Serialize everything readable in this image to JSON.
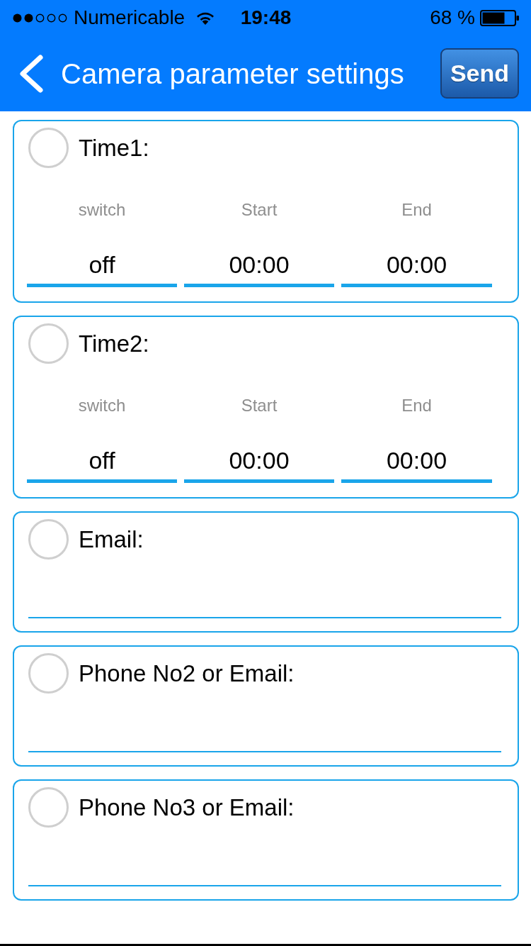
{
  "status_bar": {
    "carrier": "Numericable",
    "time": "19:48",
    "battery": "68 %"
  },
  "nav_bar": {
    "title": "Camera parameter settings",
    "send_button": "Send"
  },
  "sections": [
    {
      "kind": "schedule",
      "label": "Time1:",
      "selected": false,
      "columns": [
        {
          "header": "switch",
          "value": "off"
        },
        {
          "header": "Start",
          "value": "00:00"
        },
        {
          "header": "End",
          "value": "00:00"
        }
      ]
    },
    {
      "kind": "schedule",
      "label": "Time2:",
      "selected": false,
      "columns": [
        {
          "header": "switch",
          "value": "off"
        },
        {
          "header": "Start",
          "value": "00:00"
        },
        {
          "header": "End",
          "value": "00:00"
        }
      ]
    },
    {
      "kind": "contact",
      "label": "Email:",
      "selected": false
    },
    {
      "kind": "contact",
      "label": "Phone No2 or Email:",
      "selected": false
    },
    {
      "kind": "contact",
      "label": "Phone No3 or Email:",
      "selected": false
    }
  ]
}
